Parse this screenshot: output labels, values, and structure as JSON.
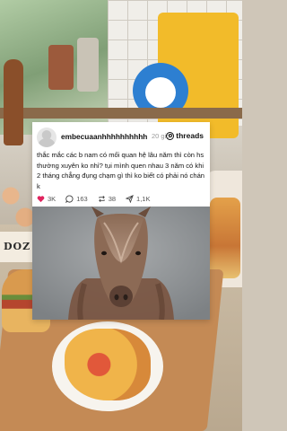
{
  "background": {
    "egg_box_label": "DOZ"
  },
  "post": {
    "username": "embecuaanhhhhhhhhhh",
    "time": "20 giờ",
    "brand": "threads",
    "text": "thắc mắc các b nam có mối quan hệ lâu năm thì còn hs thường xuyên ko nhỉ? tụi mình quen nhau 3 năm có khi 2 tháng chẳng đụng chạm gì thì ko biết có phải nó chán k",
    "likes": "3K",
    "comments": "163",
    "reposts": "38",
    "shares": "1,1K"
  },
  "colors": {
    "like_red": "#e0245e",
    "card_bg": "#ffffff"
  },
  "icons": [
    "heart-icon",
    "comment-icon",
    "repost-icon",
    "share-icon",
    "threads-logo-icon",
    "avatar-icon"
  ]
}
